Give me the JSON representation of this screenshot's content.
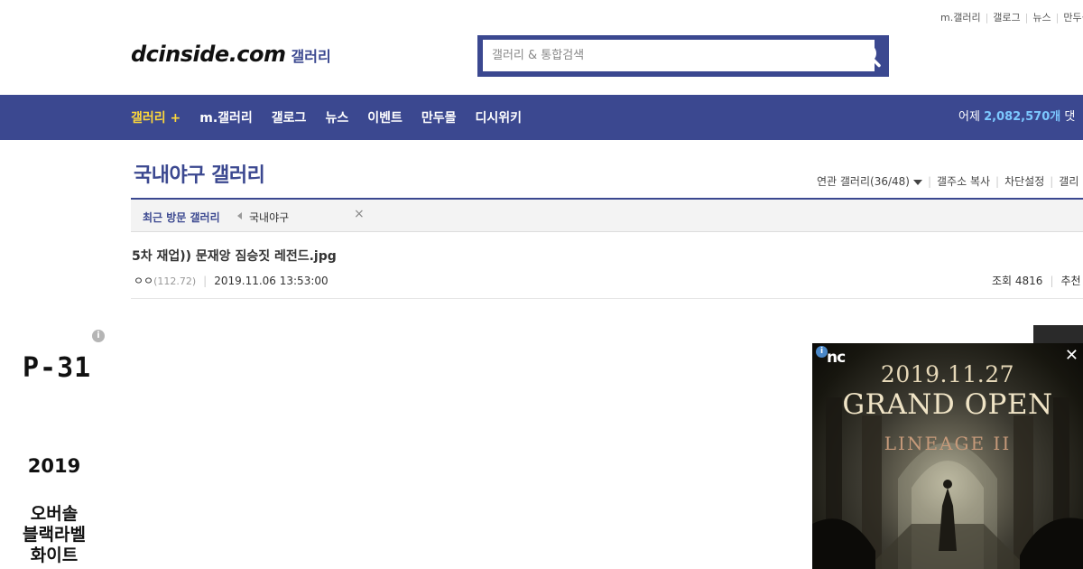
{
  "top_links": [
    "m.갤러리",
    "갤로그",
    "뉴스",
    "만두몰"
  ],
  "logo": {
    "brand": "dcinside.com",
    "sub": "갤러리"
  },
  "search": {
    "placeholder": "갤러리 & 통합검색",
    "icon": "search-icon"
  },
  "nav": {
    "items": [
      {
        "label": "갤러리 +",
        "active": true
      },
      {
        "label": "m.갤러리",
        "active": false
      },
      {
        "label": "갤로그",
        "active": false
      },
      {
        "label": "뉴스",
        "active": false
      },
      {
        "label": "이벤트",
        "active": false
      },
      {
        "label": "만두몰",
        "active": false
      },
      {
        "label": "디시위키",
        "active": false
      }
    ],
    "stats_prefix": "어제",
    "stats_value": "2,082,570개",
    "stats_suffix": "댓"
  },
  "gallery": {
    "title": "국내야구 갤러리",
    "related": "연관 갤러리(36/48)",
    "copy_address": "갤주소 복사",
    "block_settings": "차단설정",
    "more": "갤리"
  },
  "recent": {
    "label": "최근 방문 갤러리",
    "item": "국내야구"
  },
  "post": {
    "title": "5차 재업)) 문재앙 짐승짓 레전드.jpg",
    "author": "ㅇㅇ",
    "ip": "(112.72)",
    "datetime": "2019.11.06 13:53:00",
    "views_label": "조회 4816",
    "recommend_label": "추천"
  },
  "left_ad": {
    "model": "P-31",
    "year": "2019",
    "name_lines": [
      "오버솔",
      "블랙라벨",
      "화이트"
    ]
  },
  "right_ad": {
    "brand": "nc",
    "date": "2019.11.27",
    "headline": "GRAND OPEN",
    "game": "LINEAGE II"
  },
  "colors": {
    "brand_blue": "#3b4890",
    "active_nav": "#fed83a",
    "stats_number": "#7cc8ff"
  }
}
